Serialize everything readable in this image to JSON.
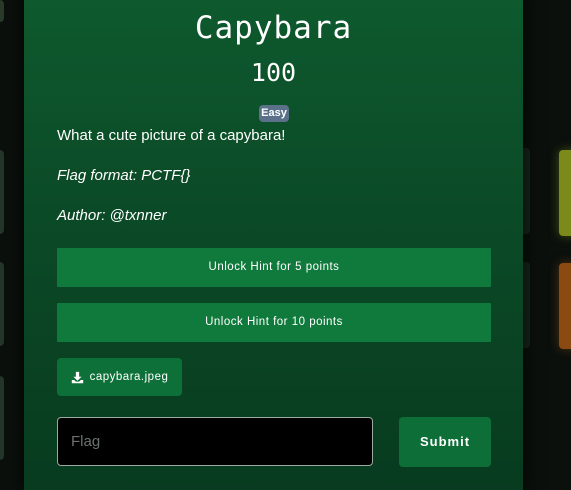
{
  "challenge": {
    "title": "Capybara",
    "points": "100",
    "difficulty": "Easy",
    "description": "What a cute picture of a capybara!",
    "flag_format": "Flag format: PCTF{}",
    "author": "Author: @txnner"
  },
  "hints": [
    {
      "label": "Unlock Hint for 5 points"
    },
    {
      "label": "Unlock Hint for 10 points"
    }
  ],
  "file": {
    "name": "capybara.jpeg",
    "icon": "download-icon"
  },
  "flag_input": {
    "placeholder": "Flag",
    "value": ""
  },
  "submit": {
    "label": "Submit"
  },
  "colors": {
    "modal_bg": "#0b4a27",
    "button_green": "#107a3c",
    "badge_easy": "#5a7189",
    "card_yellow": "#7b8a1a",
    "card_orange": "#8a4a12"
  }
}
